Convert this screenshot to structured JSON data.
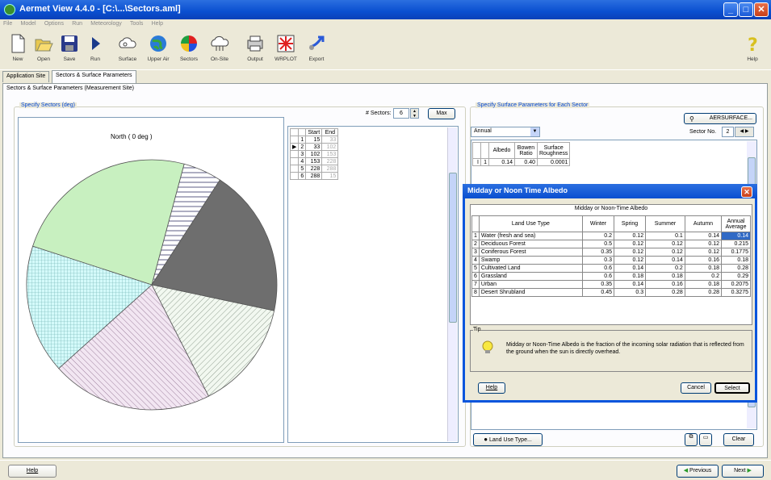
{
  "window": {
    "title": "Aermet View 4.4.0 - [C:\\...\\Sectors.aml]"
  },
  "menu": [
    "File",
    "Model",
    "Options",
    "Run",
    "Meteorology",
    "Tools",
    "Help"
  ],
  "toolbar": [
    "New",
    "Open",
    "Save",
    "Run",
    "Surface",
    "Upper Air",
    "Sectors",
    "On-Site",
    "Output",
    "WRPLOT",
    "Export"
  ],
  "toolbar_help": "Help",
  "tabs": [
    "Application Site",
    "Sectors & Surface Parameters"
  ],
  "main_group_title": "Sectors & Surface Parameters (Measurement Site)",
  "sectors_group_title": "Specify Sectors (deg)",
  "pie_label": "North ( 0 deg )",
  "sectors_count_label": "# Sectors:",
  "sectors_count_value": "6",
  "max_button": "Max",
  "sector_table": {
    "headers": [
      "",
      "Start",
      "End"
    ],
    "rows": [
      [
        "1",
        "15",
        "33"
      ],
      [
        "2",
        "33",
        "102"
      ],
      [
        "3",
        "102",
        "153"
      ],
      [
        "4",
        "153",
        "228"
      ],
      [
        "5",
        "228",
        "288"
      ],
      [
        "6",
        "288",
        "15"
      ]
    ]
  },
  "surface_group_title": "Specify Surface Parameters for Each Sector",
  "aersurface_button": "AERSURFACE...",
  "period_select": "Annual",
  "sector_no_label": "Sector No.",
  "sector_no_value": "2",
  "surface_table": {
    "headers": [
      "",
      "Albedo",
      "Bowen Ratio",
      "Surface Roughness"
    ],
    "row": [
      "1",
      "0.14",
      "0.40",
      "0.0001"
    ]
  },
  "dialog": {
    "title": "Midday or Noon Time Albedo",
    "subtitle": "Midday or Noon-Time Albedo",
    "headers": [
      "",
      "Land Use Type",
      "Winter",
      "Spring",
      "Summer",
      "Autumn",
      "Annual Average"
    ],
    "rows": [
      [
        "1",
        "Water (fresh and sea)",
        "0.2",
        "0.12",
        "0.1",
        "0.14",
        "0.14"
      ],
      [
        "2",
        "Deciduous Forest",
        "0.5",
        "0.12",
        "0.12",
        "0.12",
        "0.215"
      ],
      [
        "3",
        "Coniferous Forest",
        "0.35",
        "0.12",
        "0.12",
        "0.12",
        "0.1775"
      ],
      [
        "4",
        "Swamp",
        "0.3",
        "0.12",
        "0.14",
        "0.16",
        "0.18"
      ],
      [
        "5",
        "Cultivated Land",
        "0.6",
        "0.14",
        "0.2",
        "0.18",
        "0.28"
      ],
      [
        "6",
        "Grassland",
        "0.6",
        "0.18",
        "0.18",
        "0.2",
        "0.29"
      ],
      [
        "7",
        "Urban",
        "0.35",
        "0.14",
        "0.16",
        "0.18",
        "0.2075"
      ],
      [
        "8",
        "Desert Shrubland",
        "0.45",
        "0.3",
        "0.28",
        "0.28",
        "0.3275"
      ]
    ],
    "tip_label": "Tip",
    "tip_text": "Midday or Noon-Time Albedo is the fraction of the incoming solar radiation that is reflected from the ground when the sun is directly overhead.",
    "help": "Help",
    "cancel": "Cancel",
    "select": "Select"
  },
  "land_use_button": "Land Use Type...",
  "clear_button": "Clear",
  "status_help": "Help",
  "previous_button": "Previous",
  "next_button": "Next"
}
